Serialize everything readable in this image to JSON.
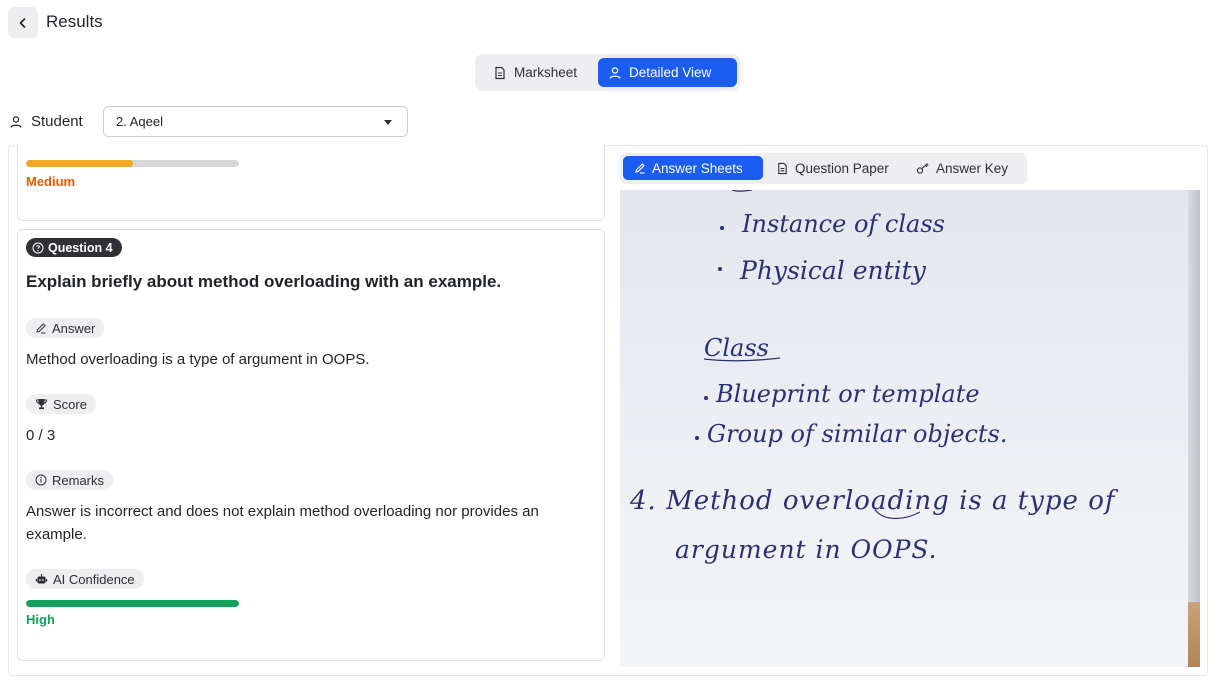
{
  "header": {
    "title": "Results"
  },
  "view_toggle": {
    "marksheet_label": "Marksheet",
    "detailed_label": "Detailed View"
  },
  "student": {
    "label": "Student",
    "selected": "2. Aqeel"
  },
  "prev_question": {
    "confidence_label": "Medium",
    "confidence_value": 0.5,
    "confidence_color": "#f5a623",
    "label_color": "#e8590c"
  },
  "question": {
    "badge": "Question 4",
    "text": "Explain briefly about method overloading with an example.",
    "answer_label": "Answer",
    "answer": "Method overloading is a type of argument in OOPS.",
    "score_label": "Score",
    "score": "0 / 3",
    "remarks_label": "Remarks",
    "remarks_line1": "Answer is incorrect and does not explain method overloading nor provides an",
    "remarks_line2": "example.",
    "confidence_chip": "AI Confidence",
    "confidence_label": "High",
    "confidence_value": 1.0,
    "confidence_color": "#14a05a"
  },
  "right_tabs": {
    "answer_sheets": "Answer Sheets",
    "question_paper": "Question Paper",
    "answer_key": "Answer Key"
  },
  "colors": {
    "accent": "#1b5cf2"
  }
}
